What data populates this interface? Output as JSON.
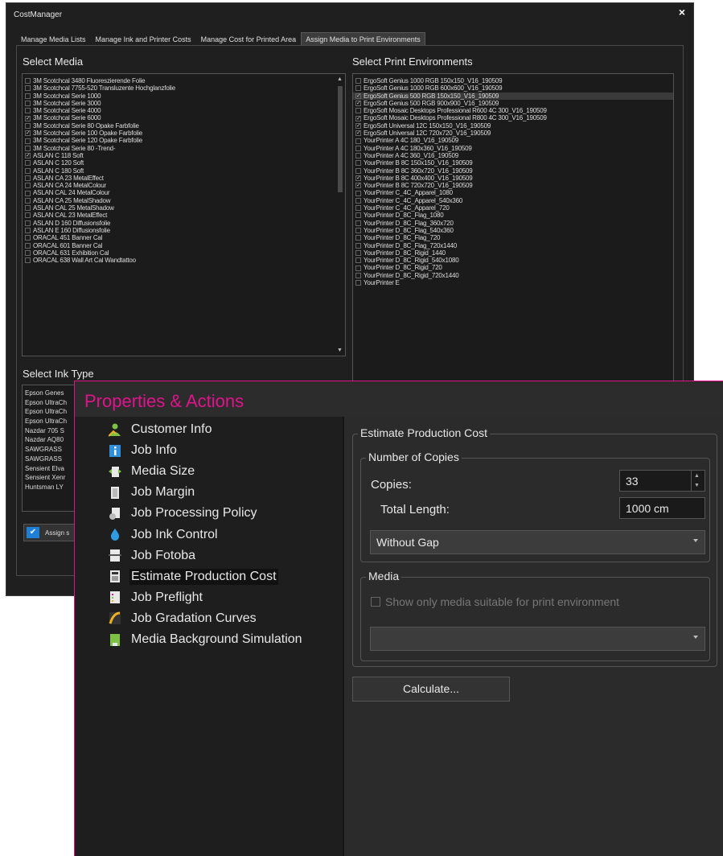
{
  "cost_manager": {
    "title": "CostManager",
    "close_glyph": "×",
    "tabs": [
      "Manage Media Lists",
      "Manage Ink and Printer Costs",
      "Manage Cost for Printed Area",
      "Assign Media to Print Environments"
    ],
    "active_tab": 3,
    "select_media_title": "Select Media",
    "select_print_env_title": "Select Print Environments",
    "select_ink_type_title": "Select Ink Type",
    "media_items": [
      {
        "label": "3M Scotchcal 3480 Fluoreszierende Folie",
        "checked": false
      },
      {
        "label": "3M Scotchcal 7755-520 Transluzente Hochglanzfolie",
        "checked": false
      },
      {
        "label": "3M Scotchcal Serie 1000",
        "checked": false
      },
      {
        "label": "3M Scotchcal Serie 3000",
        "checked": false
      },
      {
        "label": "3M Scotchcal Serie 4000",
        "checked": false
      },
      {
        "label": "3M Scotchcal Serie 6000",
        "checked": true
      },
      {
        "label": "3M Scotchcal Serie 80 Opake Farbfolie",
        "checked": false
      },
      {
        "label": "3M Scotchcal Serie 100 Opake Farbfolie",
        "checked": true
      },
      {
        "label": "3M Scotchcal Serie 120 Opake Farbfolie",
        "checked": false
      },
      {
        "label": "3M Scotchcal Serie 80 -Trend-",
        "checked": false
      },
      {
        "label": "ASLAN C 118 Soft",
        "checked": true
      },
      {
        "label": "ASLAN C 120 Soft",
        "checked": false
      },
      {
        "label": "ASLAN C 180 Soft",
        "checked": false
      },
      {
        "label": "ASLAN CA 23 MetalEffect",
        "checked": false
      },
      {
        "label": "ASLAN CA 24 MetalColour",
        "checked": false
      },
      {
        "label": "ASLAN CAL 24 MetalColour",
        "checked": false
      },
      {
        "label": "ASLAN CA 25 MetalShadow",
        "checked": false
      },
      {
        "label": "ASLAN CAL 25 MetalShadow",
        "checked": false
      },
      {
        "label": "ASLAN CAL 23 MetalEffect",
        "checked": false
      },
      {
        "label": "ASLAN D 160 Diffusionsfolie",
        "checked": false
      },
      {
        "label": "ASLAN E 160 Diffusionsfolie",
        "checked": false
      },
      {
        "label": "ORACAL 451 Banner Cal",
        "checked": false
      },
      {
        "label": "ORACAL 601 Banner Cal",
        "checked": false
      },
      {
        "label": "ORACAL 631 Exhibition Cal",
        "checked": false
      },
      {
        "label": "ORACAL 638 Wall Art Cal Wandtattoo",
        "checked": false
      }
    ],
    "print_env_items": [
      {
        "label": "ErgoSoft Genius 1000 RGB 150x150_V16_190509",
        "checked": false,
        "selected": false
      },
      {
        "label": "ErgoSoft Genius 1000 RGB 600x600_V16_190509",
        "checked": false,
        "selected": false
      },
      {
        "label": "ErgoSoft Genius 500 RGB 150x150_V16_190509",
        "checked": true,
        "selected": true
      },
      {
        "label": "ErgoSoft Genius 500 RGB 900x900_V16_190509",
        "checked": true,
        "selected": false
      },
      {
        "label": "ErgoSoft Mosaic Desktops Professional R600 4C 300_V16_190509",
        "checked": false,
        "selected": false
      },
      {
        "label": "ErgoSoft Mosaic Desktops Professional R800 4C 300_V16_190509",
        "checked": true,
        "selected": false
      },
      {
        "label": "ErgoSoft Universal 12C 150x150_V16_190509",
        "checked": true,
        "selected": false
      },
      {
        "label": "ErgoSoft Universal 12C 720x720_V16_190509",
        "checked": true,
        "selected": false
      },
      {
        "label": "YourPrinter A 4C 180_V16_190509",
        "checked": false,
        "selected": false
      },
      {
        "label": "YourPrinter A 4C 180x360_V16_190509",
        "checked": false,
        "selected": false
      },
      {
        "label": "YourPrinter A 4C 360_V16_190509",
        "checked": false,
        "selected": false
      },
      {
        "label": "YourPrinter B 8C 150x150_V16_190509",
        "checked": false,
        "selected": false
      },
      {
        "label": "YourPrinter B 8C 360x720_V16_190509",
        "checked": false,
        "selected": false
      },
      {
        "label": "YourPrinter B 8C 400x400_V16_190509",
        "checked": true,
        "selected": false
      },
      {
        "label": "YourPrinter B 8C 720x720_V16_190509",
        "checked": true,
        "selected": false
      },
      {
        "label": "YourPrinter C_4C_Apparel_1080",
        "checked": false,
        "selected": false
      },
      {
        "label": "YourPrinter C_4C_Apparel_540x360",
        "checked": false,
        "selected": false
      },
      {
        "label": "YourPrinter C_4C_Apparel_720",
        "checked": false,
        "selected": false
      },
      {
        "label": "YourPrinter D_8C_Flag_1080",
        "checked": false,
        "selected": false
      },
      {
        "label": "YourPrinter D_8C_Flag_360x720",
        "checked": false,
        "selected": false
      },
      {
        "label": "YourPrinter D_8C_Flag_540x360",
        "checked": false,
        "selected": false
      },
      {
        "label": "YourPrinter D_8C_Flag_720",
        "checked": false,
        "selected": false
      },
      {
        "label": "YourPrinter D_8C_Flag_720x1440",
        "checked": false,
        "selected": false
      },
      {
        "label": "YourPrinter D_8C_Rigid_1440",
        "checked": false,
        "selected": false
      },
      {
        "label": "YourPrinter D_8C_Rigid_540x1080",
        "checked": false,
        "selected": false
      },
      {
        "label": "YourPrinter D_8C_Rigid_720",
        "checked": false,
        "selected": false
      },
      {
        "label": "YourPrinter D_8C_Rigid_720x1440",
        "checked": false,
        "selected": false
      },
      {
        "label": "YourPrinter E",
        "checked": false,
        "selected": false
      }
    ],
    "ink_items": [
      "Epson Genes",
      "Epson UltraCh",
      "Epson UltraCh",
      "Epson UltraCh",
      "Nazdar 705 S",
      "Nazdar AQ80",
      "SAWGRASS",
      "SAWGRASS",
      "Sensient Elva",
      "Sensient Xenr",
      "Huntsman LY"
    ],
    "assign_button_label": "Assign s"
  },
  "properties": {
    "title": "Properties & Actions",
    "nav_items": [
      {
        "label": "Customer Info",
        "icon": "customer-icon",
        "color": "#7dc242"
      },
      {
        "label": "Job Info",
        "icon": "info-icon",
        "color": "#2f8fd8"
      },
      {
        "label": "Media Size",
        "icon": "media-size-icon",
        "color": "#7dc242"
      },
      {
        "label": "Job Margin",
        "icon": "margin-icon",
        "color": "#e8e8e8"
      },
      {
        "label": "Job Processing Policy",
        "icon": "policy-icon",
        "color": "#e8e8e8"
      },
      {
        "label": "Job Ink Control",
        "icon": "ink-drop-icon",
        "color": "#2f9be0"
      },
      {
        "label": "Job Fotoba",
        "icon": "fotoba-icon",
        "color": "#e8e8e8"
      },
      {
        "label": "Estimate Production Cost",
        "icon": "calculator-icon",
        "color": "#e8e8e8"
      },
      {
        "label": "Job Preflight",
        "icon": "preflight-icon",
        "color": "#e8e8e8"
      },
      {
        "label": "Job Gradation Curves",
        "icon": "gradation-icon",
        "color": "#f0b020"
      },
      {
        "label": "Media Background Simulation",
        "icon": "background-icon",
        "color": "#7dc242"
      }
    ],
    "active_nav": 7,
    "estimate_group": "Estimate Production Cost",
    "copies_group": "Number of Copies",
    "copies_label": "Copies:",
    "copies_value": "33",
    "total_length_label": "Total Length:",
    "total_length_value": "1000 cm",
    "gap_dropdown": "Without Gap",
    "media_group": "Media",
    "show_suitable_label": "Show only media suitable for print environment",
    "media_dropdown": "",
    "calculate_label": "Calculate...",
    "accent_color": "#e0138c"
  }
}
